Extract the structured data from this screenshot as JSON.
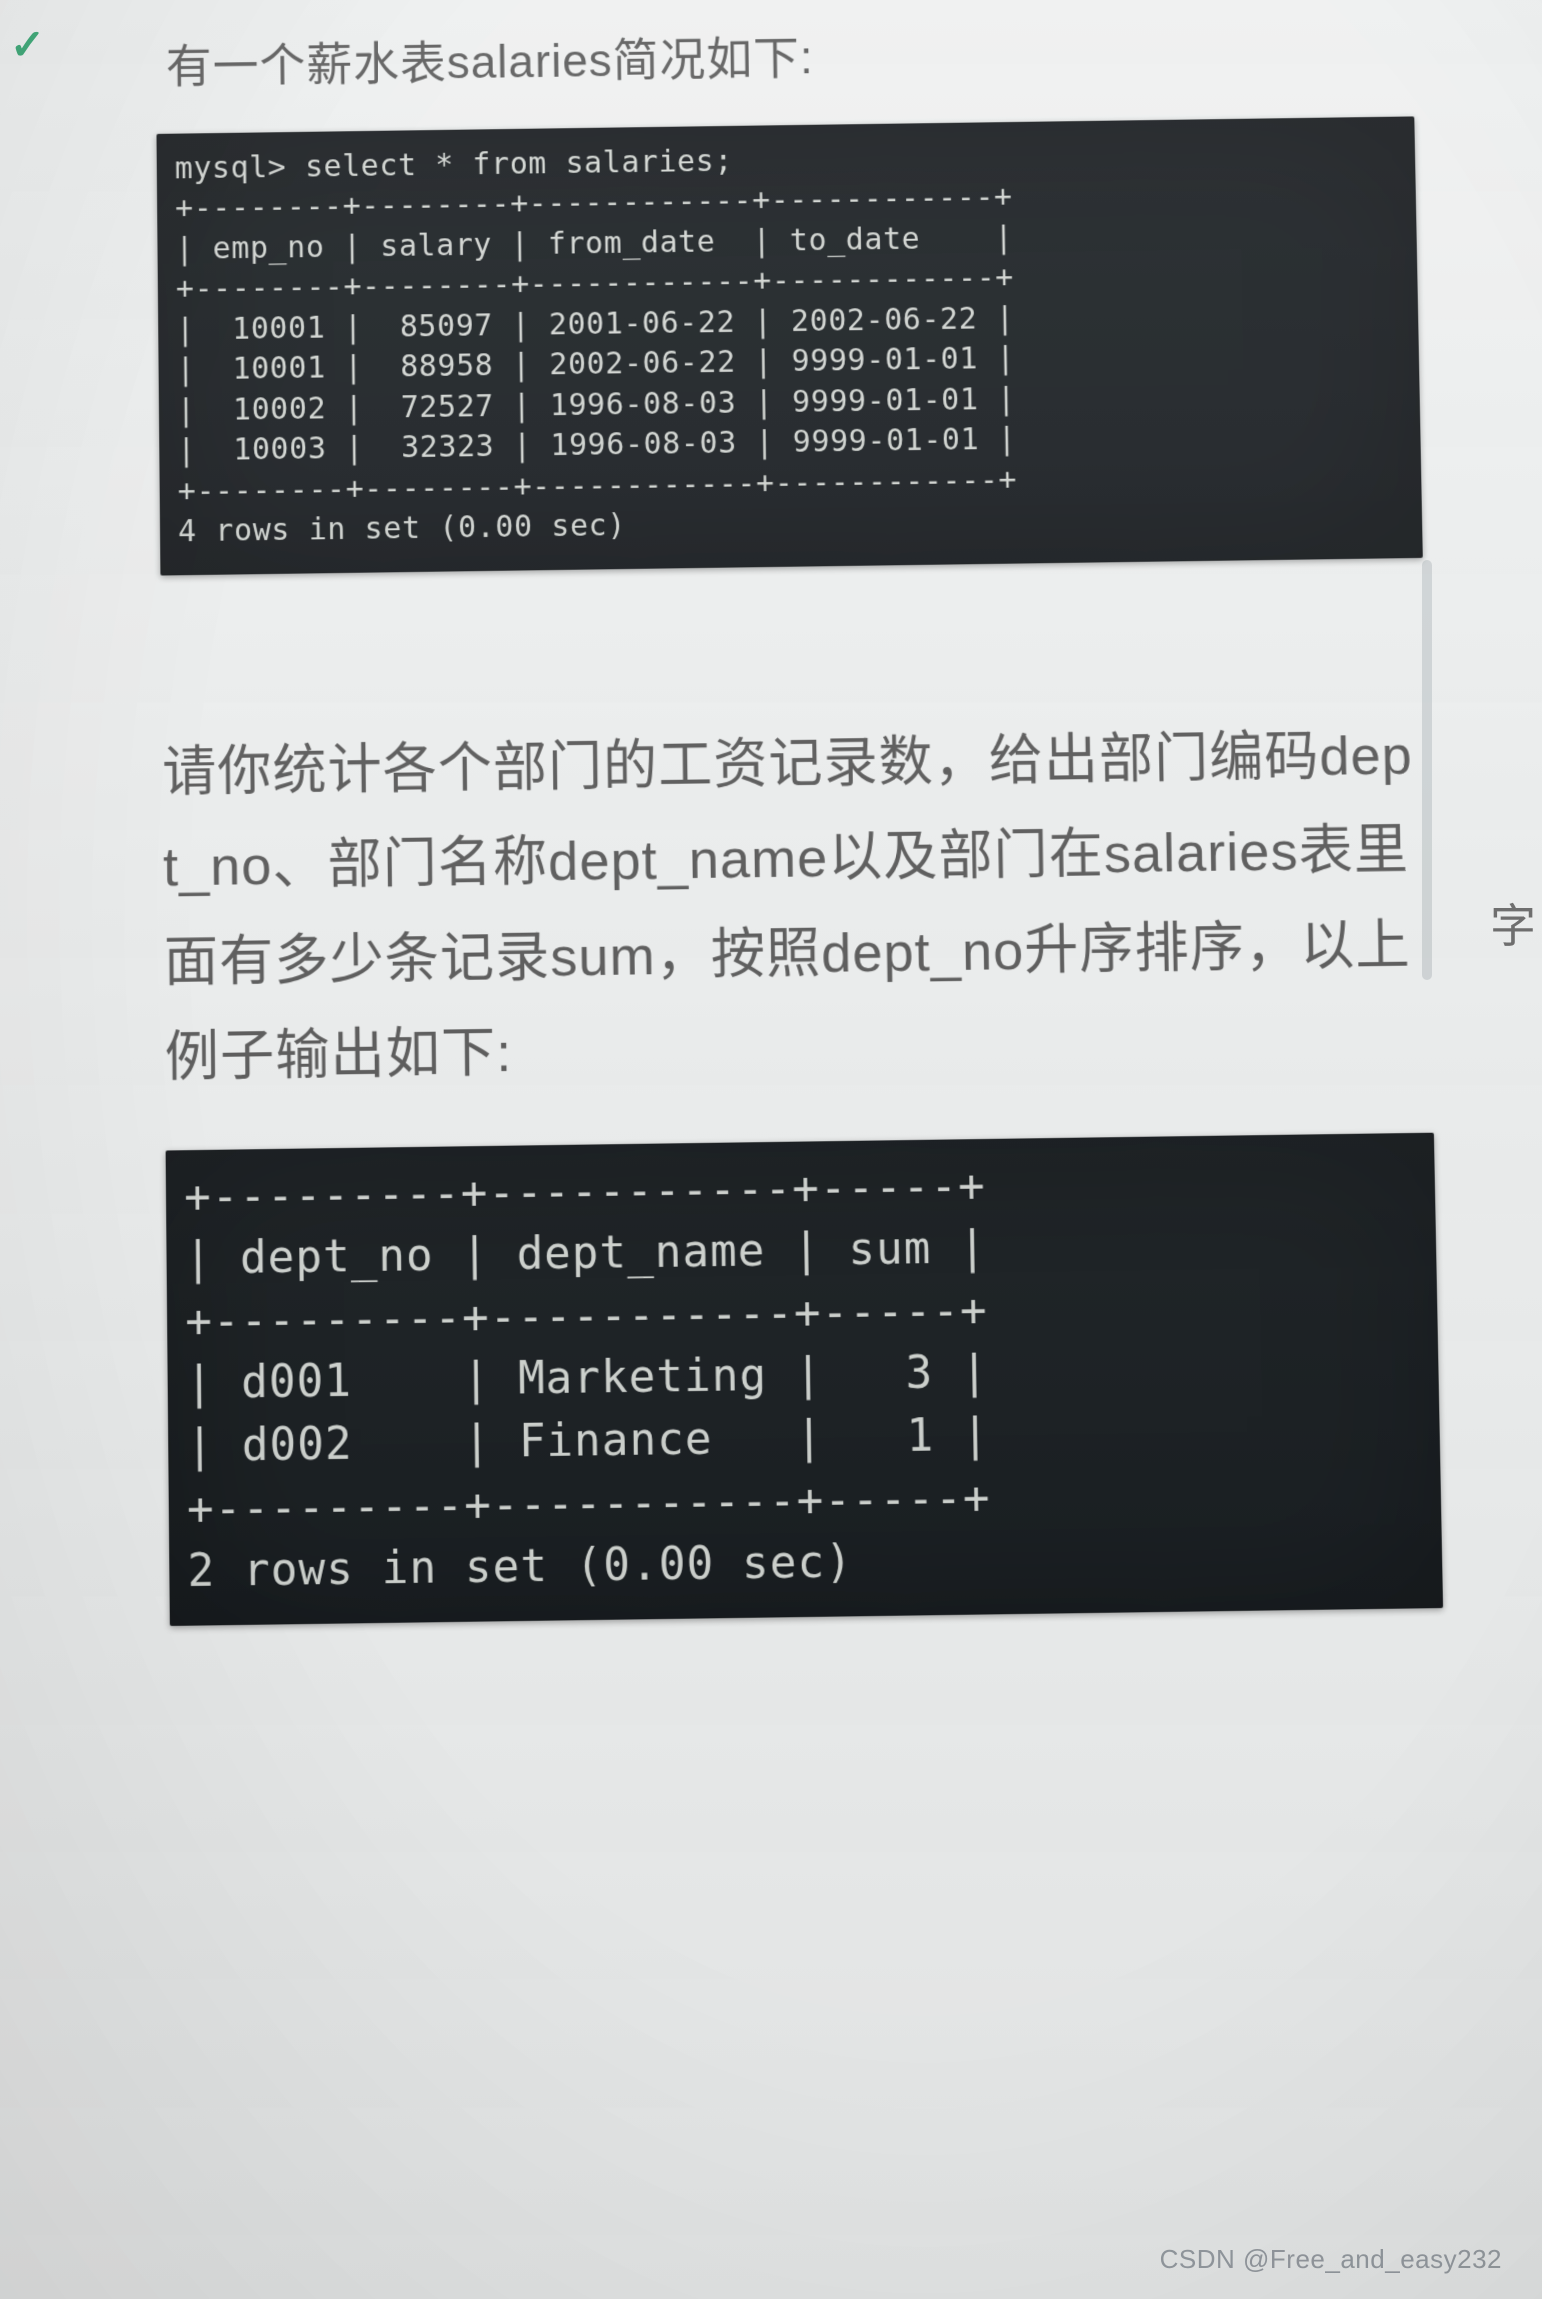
{
  "check_mark": "✓",
  "side_char": "字",
  "intro_text": "有一个薪水表salaries简况如下:",
  "query1": {
    "prompt": "mysql> select * from salaries;",
    "headers": [
      "emp_no",
      "salary",
      "from_date",
      "to_date"
    ],
    "rows": [
      [
        "10001",
        "85097",
        "2001-06-22",
        "2002-06-22"
      ],
      [
        "10001",
        "88958",
        "2002-06-22",
        "9999-01-01"
      ],
      [
        "10002",
        "72527",
        "1996-08-03",
        "9999-01-01"
      ],
      [
        "10003",
        "32323",
        "1996-08-03",
        "9999-01-01"
      ]
    ],
    "footer": "4 rows in set (0.00 sec)"
  },
  "description_text": "请你统计各个部门的工资记录数，给出部门编码dept_no、部门名称dept_name以及部门在salaries表里面有多少条记录sum，按照dept_no升序排序，以上例子输出如下:",
  "query2": {
    "headers": [
      "dept_no",
      "dept_name",
      "sum"
    ],
    "rows": [
      [
        "d001",
        "Marketing",
        "3"
      ],
      [
        "d002",
        "Finance",
        "1"
      ]
    ],
    "footer": "2 rows in set (0.00 sec)"
  },
  "watermark_text": "CSDN @Free_and_easy232"
}
